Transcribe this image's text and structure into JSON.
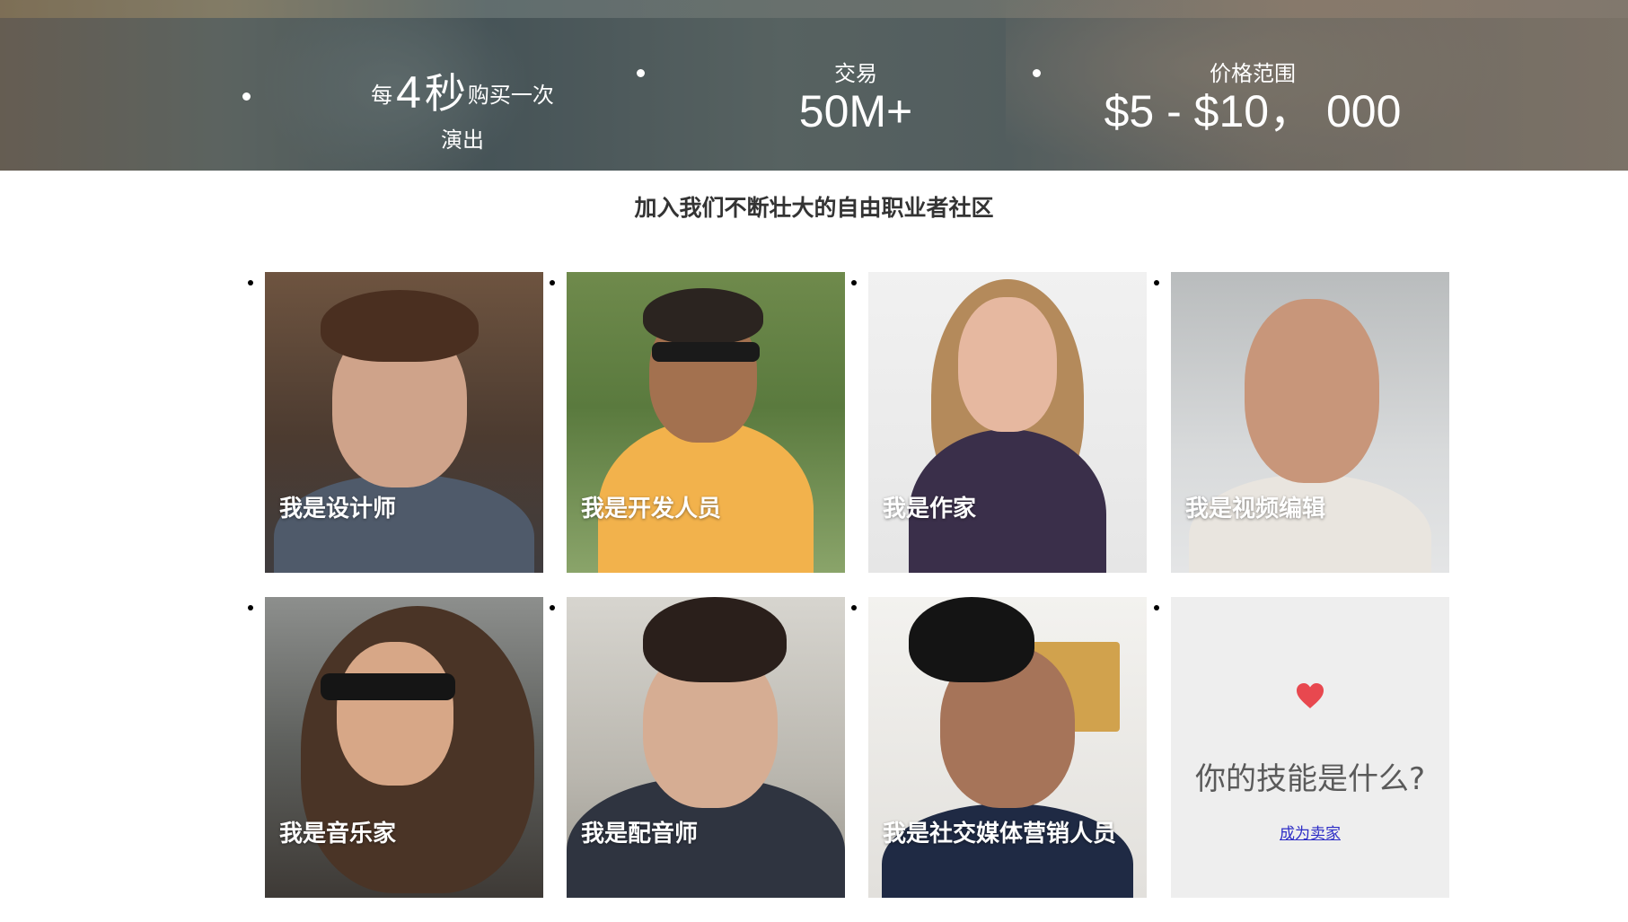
{
  "stats": {
    "gig": {
      "prefix": "每",
      "number": "4",
      "unit": "秒",
      "suffix": "购买一次",
      "line2": "演出"
    },
    "transactions": {
      "label": "交易",
      "value": "50M+"
    },
    "price_range": {
      "label": "价格范围",
      "value": "$5 - $10， 000"
    }
  },
  "community": {
    "title": "加入我们不断壮大的自由职业者社区",
    "cards": [
      {
        "label": "我是设计师"
      },
      {
        "label": "我是开发人员"
      },
      {
        "label": "我是作家"
      },
      {
        "label": "我是视频编辑"
      },
      {
        "label": "我是音乐家"
      },
      {
        "label": "我是配音师"
      },
      {
        "label": "我是社交媒体营销人员"
      }
    ],
    "cta": {
      "question": "你的技能是什么?",
      "link": "成为卖家",
      "icon": "heart-icon",
      "accent": "#e8484f"
    }
  }
}
